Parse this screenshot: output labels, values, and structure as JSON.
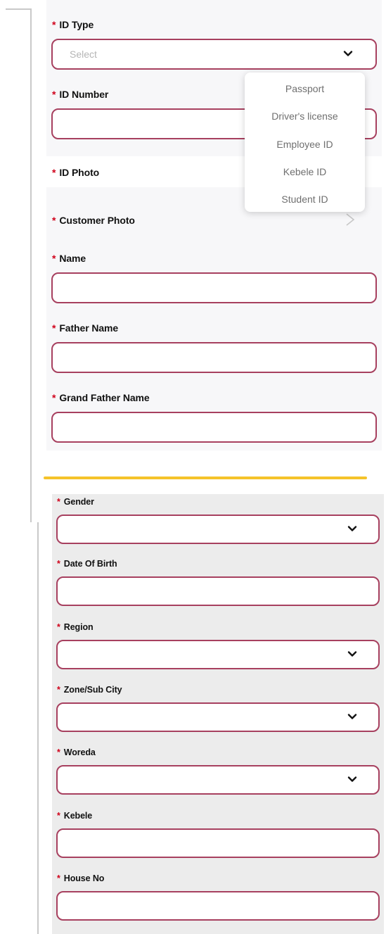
{
  "form_top": {
    "id_type": {
      "label": "ID Type",
      "placeholder": "Select"
    },
    "id_number": {
      "label": "ID Number"
    },
    "id_photo": {
      "label": "ID Photo"
    },
    "customer_photo": {
      "label": "Customer Photo"
    },
    "name": {
      "label": "Name"
    },
    "father_name": {
      "label": "Father Name"
    },
    "grand_father_name": {
      "label": "Grand Father Name"
    }
  },
  "id_type_dropdown": {
    "options": [
      "Passport",
      "Driver's license",
      "Employee ID",
      "Kebele ID",
      "Student ID"
    ]
  },
  "form_bottom": {
    "gender": {
      "label": "Gender"
    },
    "date_of_birth": {
      "label": "Date Of Birth"
    },
    "region": {
      "label": "Region"
    },
    "zone_sub_city": {
      "label": "Zone/Sub City"
    },
    "woreda": {
      "label": "Woreda"
    },
    "kebele": {
      "label": "Kebele"
    },
    "house_no": {
      "label": "House No"
    }
  },
  "required_marker": "*",
  "colors": {
    "field_border": "#a7405f",
    "required": "#d0021b",
    "divider": "#f5c32a"
  }
}
